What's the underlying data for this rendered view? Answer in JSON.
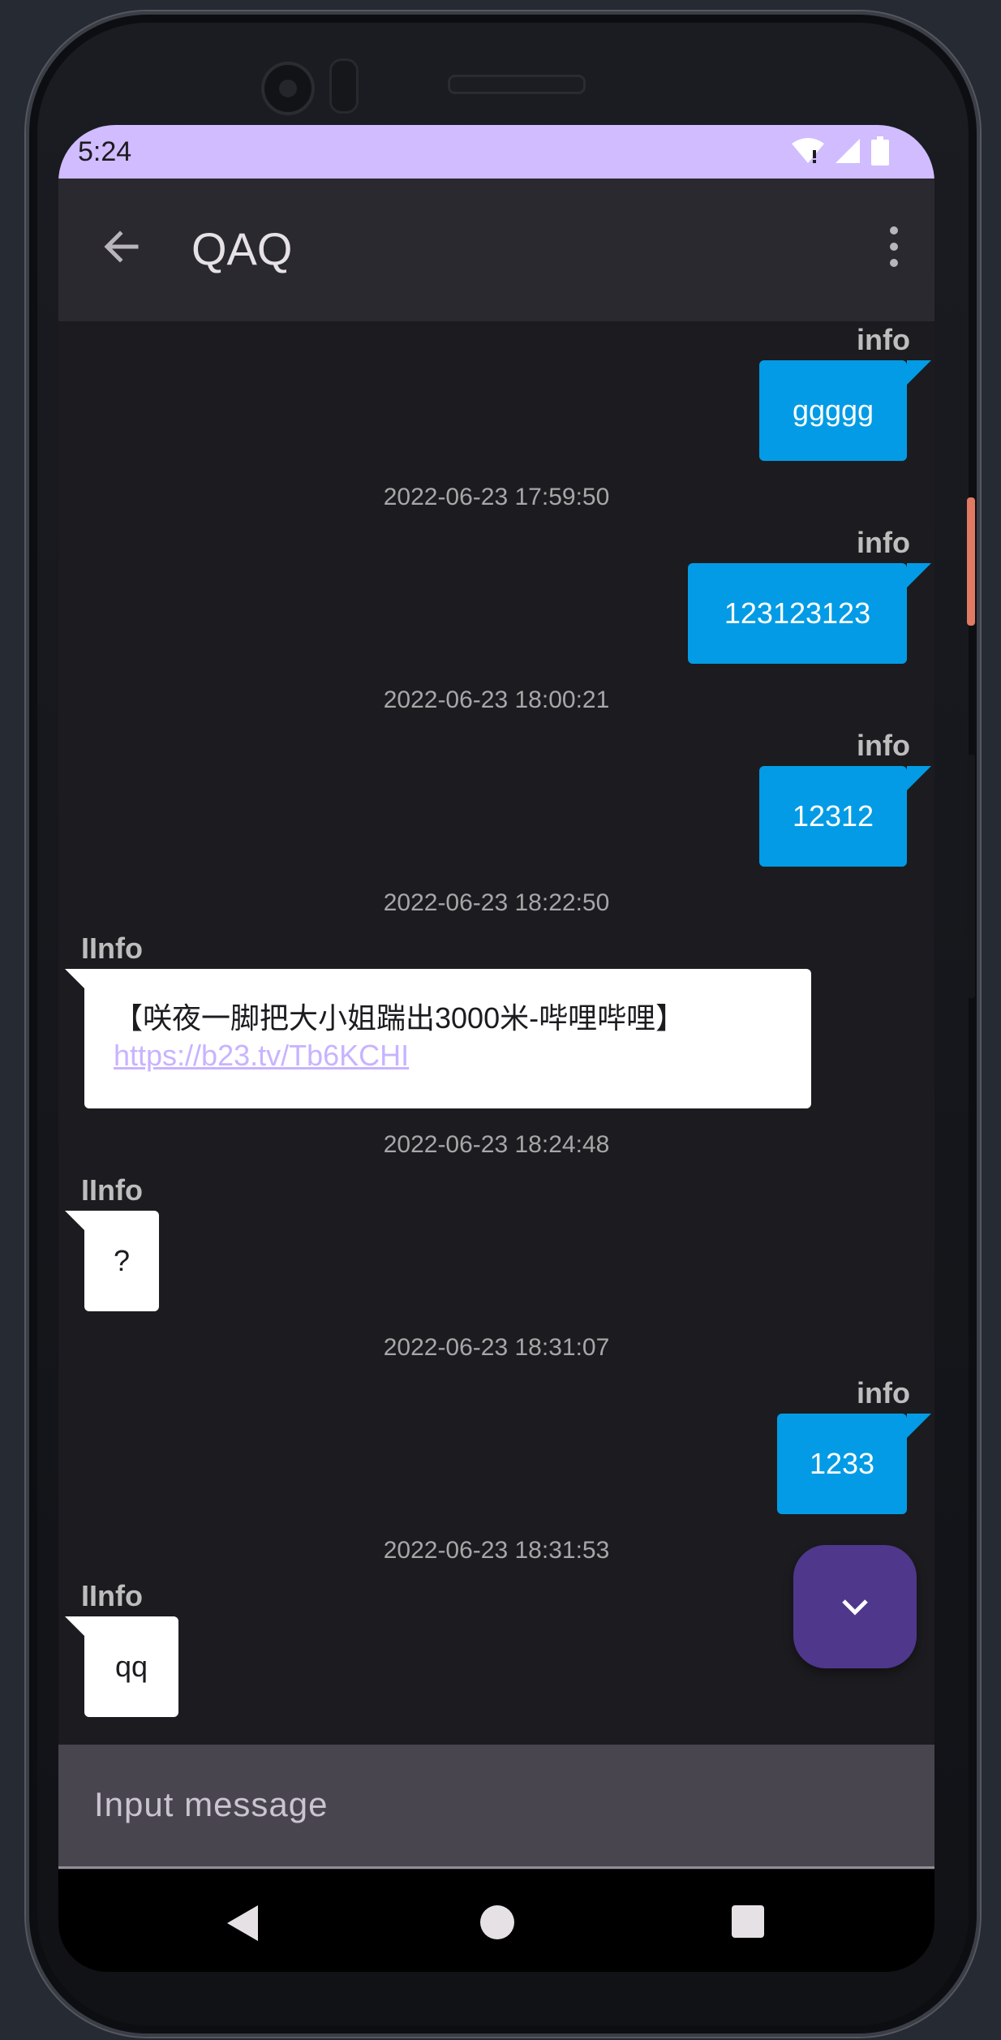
{
  "status_bar": {
    "time": "5:24"
  },
  "app_bar": {
    "title": "QAQ"
  },
  "messages": [
    {
      "sender": "info",
      "text": "ggggg"
    },
    {
      "timestamp": "2022-06-23 17:59:50",
      "sender": "info",
      "text": "123123123"
    },
    {
      "timestamp": "2022-06-23 18:00:21",
      "sender": "info",
      "text": "12312"
    },
    {
      "timestamp": "2022-06-23 18:22:50",
      "sender": "IInfo",
      "text": "【咲夜一脚把大小姐踹出3000米-哔哩哔哩】",
      "link": "https://b23.tv/Tb6KCHI"
    },
    {
      "timestamp": "2022-06-23 18:24:48",
      "sender": "IInfo",
      "text": "?"
    },
    {
      "timestamp": "2022-06-23 18:31:07",
      "sender": "info",
      "text": "1233"
    },
    {
      "timestamp": "2022-06-23 18:31:53",
      "sender": "IInfo",
      "text": "qq"
    }
  ],
  "input": {
    "placeholder": "Input message"
  },
  "icons": {
    "back": "arrow-back-icon",
    "more": "more-vert-icon",
    "scroll_down": "chevron-down-icon",
    "nav_back": "triangle-back-icon",
    "nav_home": "circle-home-icon",
    "nav_recents": "square-recents-icon"
  },
  "colors": {
    "status_bar": "#d0bcff",
    "app_bar": "#2b2930",
    "outgoing_bubble": "#039be5",
    "incoming_bubble": "#ffffff",
    "link": "#c8b3ff",
    "fab": "#4f378b",
    "input": "#49454f"
  }
}
